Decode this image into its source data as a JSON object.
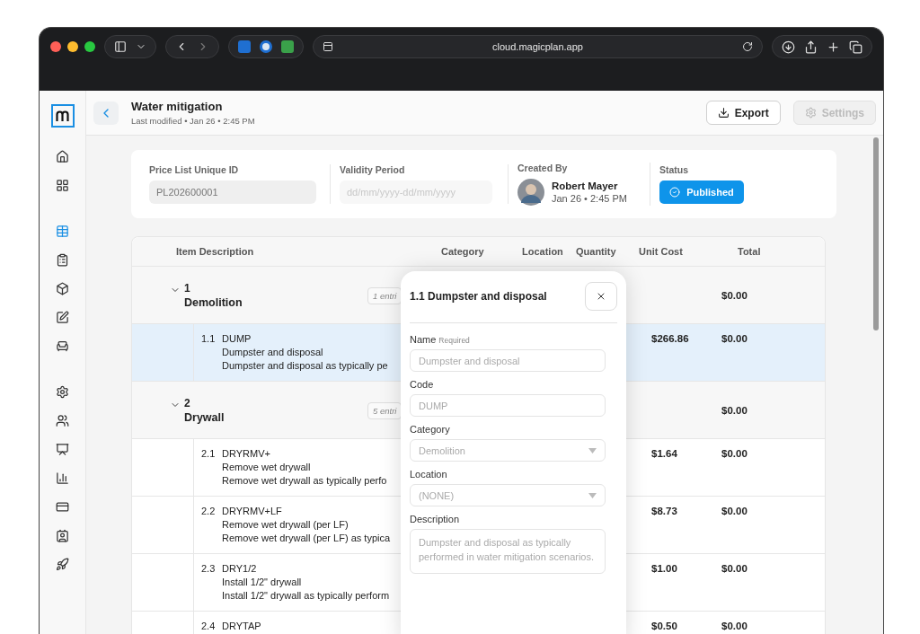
{
  "browser": {
    "url": "cloud.magicplan.app"
  },
  "header": {
    "title": "Water mitigation",
    "subtitle": "Last modified • Jan 26 • 2:45 PM",
    "buttons": [
      {
        "label": "Export",
        "kind": "export",
        "disabled": false
      },
      {
        "label": "Settings",
        "kind": "settings",
        "disabled": true
      }
    ]
  },
  "sidebar": {
    "items": [
      {
        "selected": false
      },
      {
        "selected": false
      },
      {
        "selected": true
      },
      {
        "selected": false
      },
      {
        "selected": false
      },
      {
        "selected": false
      },
      {
        "selected": false
      },
      {
        "selected": false
      },
      {
        "selected": false
      },
      {
        "selected": false
      },
      {
        "selected": false
      },
      {
        "selected": false
      },
      {
        "selected": false
      },
      {
        "selected": false
      }
    ]
  },
  "summary": {
    "price_list_id": {
      "label": "Price List Unique ID",
      "value": "PL202600001"
    },
    "validity": {
      "label": "Validity Period",
      "placeholder": "dd/mm/yyyy-dd/mm/yyyy"
    },
    "created_by": {
      "label": "Created By",
      "name": "Robert Mayer",
      "date": "Jan 26 • 2:45 PM"
    },
    "status": {
      "label": "Status",
      "value": "Published"
    }
  },
  "table": {
    "columns": [
      "Item Description",
      "Category",
      "Location",
      "Quantity",
      "Unit Cost",
      "Total"
    ],
    "groups": [
      {
        "number": "1",
        "name": "Demolition",
        "entries": "1 entri",
        "total": "$0.00",
        "expanded": true,
        "rows": [
          {
            "number": "1.1",
            "code": "DUMP",
            "name": "Dumpster and disposal",
            "description": "Dumpster and disposal as typically pe",
            "unit_cost": "$266.86",
            "total": "$0.00",
            "selected": true
          }
        ]
      },
      {
        "number": "2",
        "name": "Drywall",
        "entries": "5 entri",
        "total": "$0.00",
        "expanded": true,
        "rows": [
          {
            "number": "2.1",
            "code": "DRYRMV+",
            "name": "Remove wet drywall",
            "description": "Remove wet drywall as typically perfo",
            "unit_cost": "$1.64",
            "total": "$0.00",
            "selected": false
          },
          {
            "number": "2.2",
            "code": "DRYRMV+LF",
            "name": "Remove wet drywall (per LF)",
            "description": "Remove wet drywall (per LF) as typica",
            "unit_cost": "$8.73",
            "total": "$0.00",
            "selected": false
          },
          {
            "number": "2.3",
            "code": "DRY1/2",
            "name": "Install 1/2\" drywall",
            "description": "Install 1/2\" drywall as typically perform",
            "unit_cost": "$1.00",
            "total": "$0.00",
            "selected": false
          },
          {
            "number": "2.4",
            "code": "DRYTAP",
            "unit_cost": "$0.50",
            "total": "$0.00",
            "selected": false
          }
        ]
      }
    ]
  },
  "panel": {
    "title": "1.1 Dumpster and disposal",
    "fields": [
      {
        "kind": "text",
        "label": "Name",
        "hint": "Required",
        "value": "Dumpster and disposal"
      },
      {
        "kind": "text",
        "label": "Code",
        "value": "DUMP"
      },
      {
        "kind": "select",
        "label": "Category",
        "value": "Demolition"
      },
      {
        "kind": "select",
        "label": "Location",
        "value": "(NONE)"
      },
      {
        "kind": "textarea",
        "label": "Description",
        "value": "Dumpster and disposal as typically performed in water mitigation scenarios."
      }
    ]
  }
}
